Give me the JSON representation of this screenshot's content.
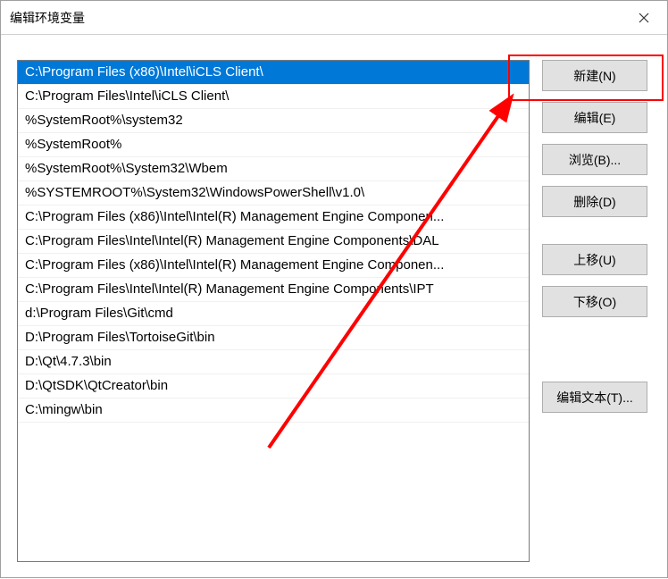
{
  "window": {
    "title": "编辑环境变量"
  },
  "list": {
    "items": [
      "C:\\Program Files (x86)\\Intel\\iCLS Client\\",
      "C:\\Program Files\\Intel\\iCLS Client\\",
      "%SystemRoot%\\system32",
      "%SystemRoot%",
      "%SystemRoot%\\System32\\Wbem",
      "%SYSTEMROOT%\\System32\\WindowsPowerShell\\v1.0\\",
      "C:\\Program Files (x86)\\Intel\\Intel(R) Management Engine Componen...",
      "C:\\Program Files\\Intel\\Intel(R) Management Engine Components\\DAL",
      "C:\\Program Files (x86)\\Intel\\Intel(R) Management Engine Componen...",
      "C:\\Program Files\\Intel\\Intel(R) Management Engine Components\\IPT",
      "d:\\Program Files\\Git\\cmd",
      "D:\\Program Files\\TortoiseGit\\bin",
      "D:\\Qt\\4.7.3\\bin",
      "D:\\QtSDK\\QtCreator\\bin",
      "C:\\mingw\\bin"
    ],
    "selected_index": 0
  },
  "buttons": {
    "new": "新建(N)",
    "edit": "编辑(E)",
    "browse": "浏览(B)...",
    "delete": "删除(D)",
    "moveup": "上移(U)",
    "movedown": "下移(O)",
    "edittext": "编辑文本(T)..."
  },
  "annotation": {
    "arrow_color": "#ff0000",
    "highlight_color": "#ff0000"
  }
}
